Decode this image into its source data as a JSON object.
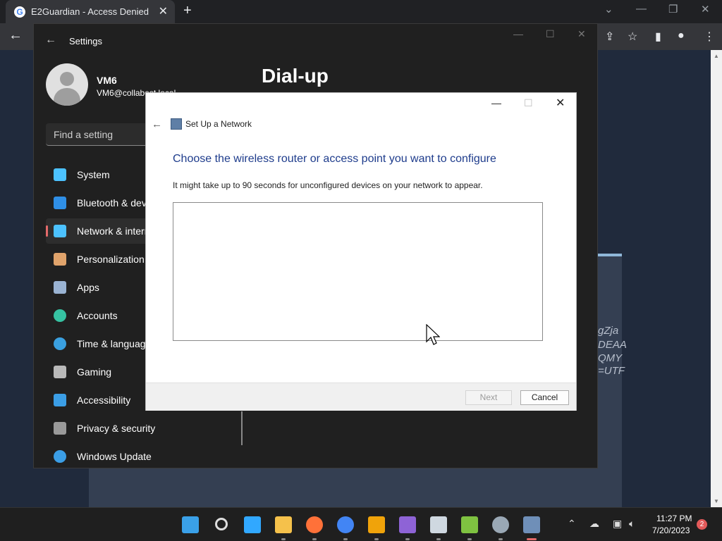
{
  "browser": {
    "tab_title": "E2Guardian - Access Denied",
    "tab_close": "✕",
    "new_tab": "+",
    "page_code": [
      "gZja",
      "DEAA",
      "QMY",
      "=UTF"
    ]
  },
  "settings": {
    "app_title": "Settings",
    "user_name": "VM6",
    "user_email": "VM6@collabest.local",
    "search_placeholder": "Find a setting",
    "page_title": "Dial-up",
    "nav": [
      {
        "label": "System",
        "icon": "monitor-icon",
        "color": "#4cc2ff"
      },
      {
        "label": "Bluetooth & devices",
        "icon": "bluetooth-icon",
        "color": "#2f8fe6"
      },
      {
        "label": "Network & internet",
        "icon": "wifi-icon",
        "color": "#4cc2ff",
        "active": true
      },
      {
        "label": "Personalization",
        "icon": "brush-icon",
        "color": "#e0a36b"
      },
      {
        "label": "Apps",
        "icon": "apps-icon",
        "color": "#9ab3d3"
      },
      {
        "label": "Accounts",
        "icon": "person-icon",
        "color": "#36c2a2"
      },
      {
        "label": "Time & language",
        "icon": "globe-clock-icon",
        "color": "#3aa0e0"
      },
      {
        "label": "Gaming",
        "icon": "gamepad-icon",
        "color": "#b9b9b9"
      },
      {
        "label": "Accessibility",
        "icon": "accessibility-icon",
        "color": "#3b9ee6"
      },
      {
        "label": "Privacy & security",
        "icon": "shield-icon",
        "color": "#9a9a9a"
      },
      {
        "label": "Windows Update",
        "icon": "update-icon",
        "color": "#3b9ee6"
      }
    ]
  },
  "dialog": {
    "title": "Set Up a Network",
    "heading": "Choose the wireless router or access point you want to configure",
    "description": "It might take up to 90 seconds for unconfigured devices on your network to appear.",
    "next_label": "Next",
    "cancel_label": "Cancel"
  },
  "taskbar": {
    "time": "11:27 PM",
    "date": "7/20/2023",
    "notification_count": "2",
    "apps": [
      "start-icon",
      "search-icon",
      "photoshop-icon",
      "file-explorer-icon",
      "firefox-icon",
      "chrome-icon",
      "store-icon",
      "visual-studio-icon",
      "keyboard-icon",
      "notepadpp-icon",
      "settings-gear-icon",
      "network-setup-icon"
    ]
  },
  "colors": {
    "accent": "#4cc2ff",
    "dialog_heading": "#1e3c8c"
  }
}
